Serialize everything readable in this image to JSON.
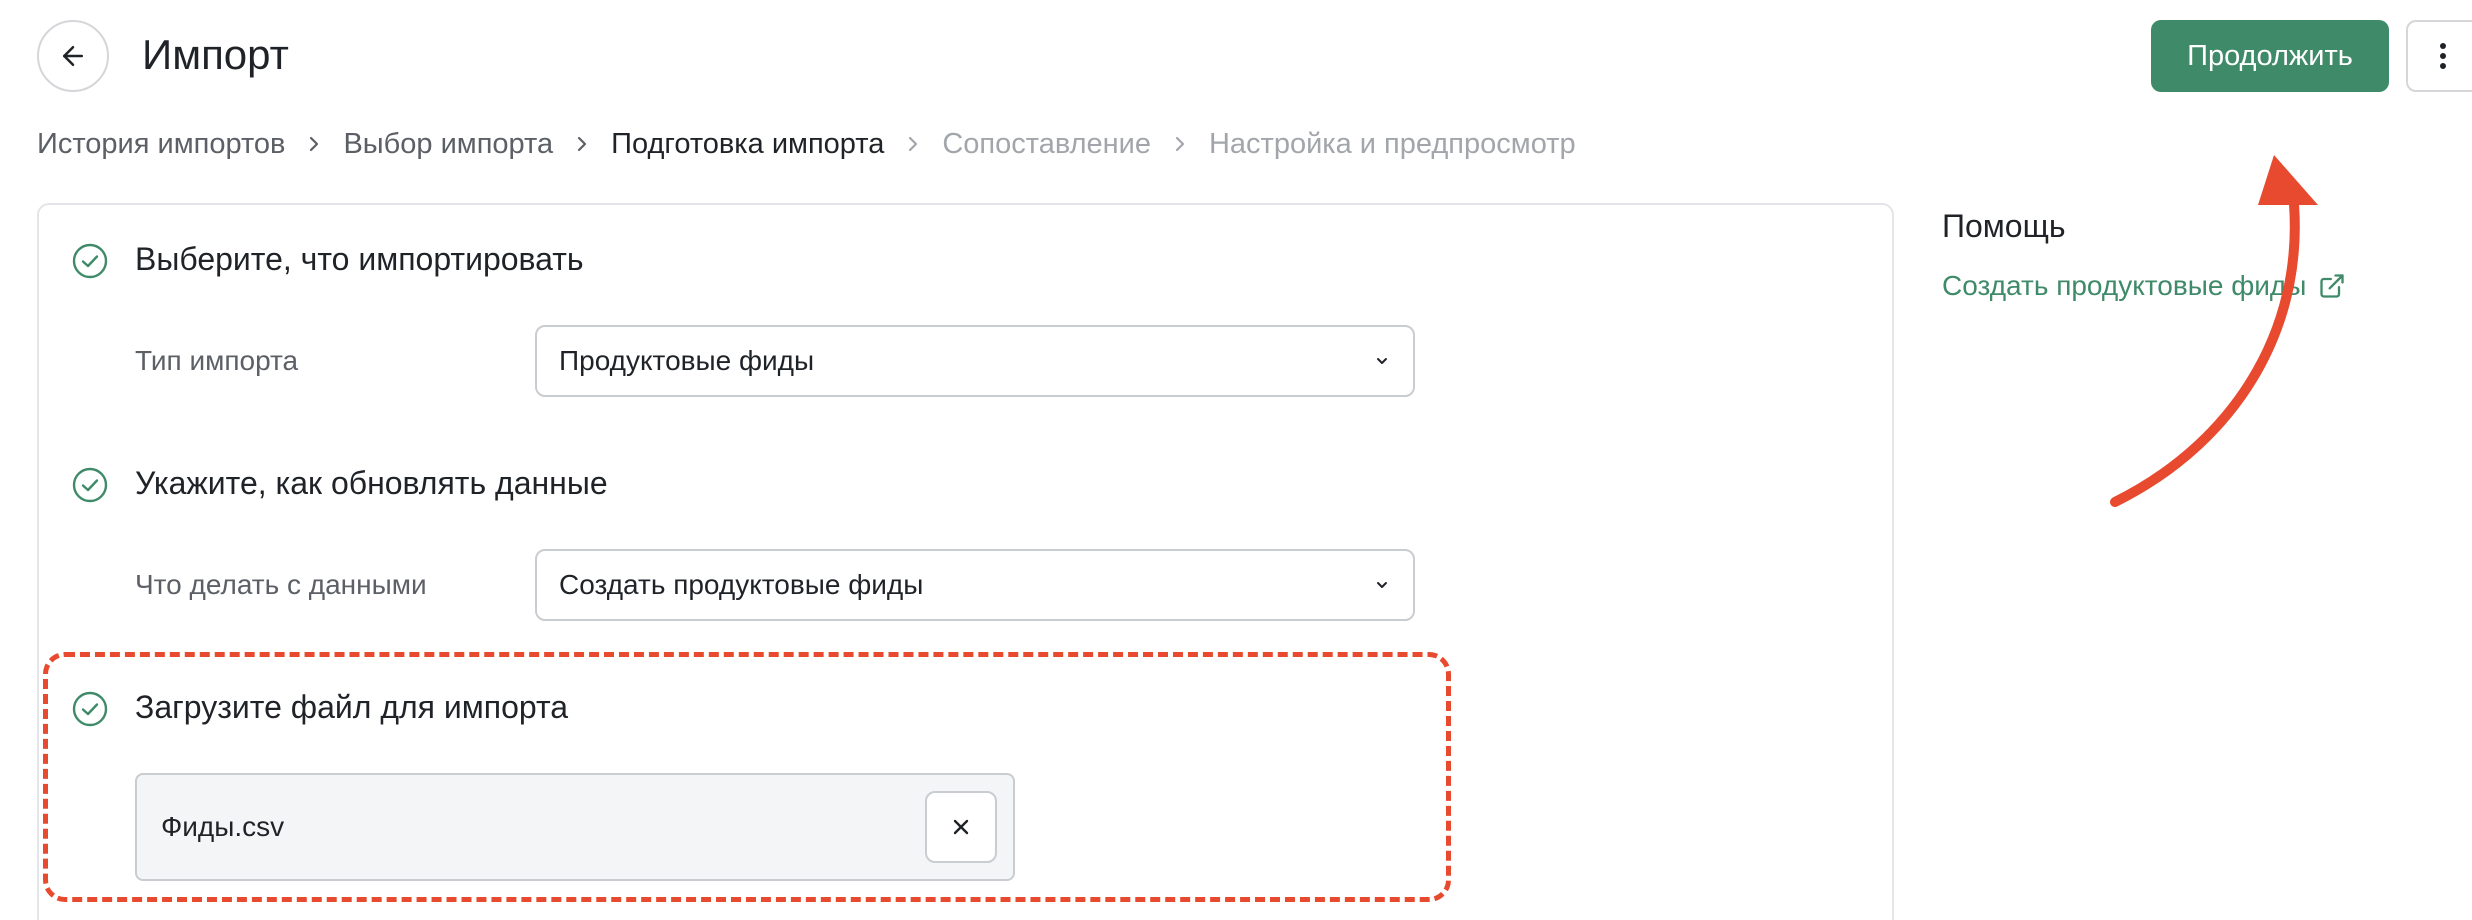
{
  "header": {
    "title": "Импорт",
    "continue_label": "Продолжить"
  },
  "breadcrumb": [
    {
      "label": "История импортов",
      "state": "done"
    },
    {
      "label": "Выбор импорта",
      "state": "done"
    },
    {
      "label": "Подготовка импорта",
      "state": "current"
    },
    {
      "label": "Сопоставление",
      "state": "future"
    },
    {
      "label": "Настройка и предпросмотр",
      "state": "future"
    }
  ],
  "sections": {
    "what": {
      "title": "Выберите, что импортировать",
      "field_label": "Тип импорта",
      "select_value": "Продуктовые фиды"
    },
    "how": {
      "title": "Укажите, как обновлять данные",
      "field_label": "Что делать с данными",
      "select_value": "Создать продуктовые фиды"
    },
    "upload": {
      "title": "Загрузите файл для импорта",
      "file_name": "Фиды.csv"
    }
  },
  "help": {
    "title": "Помощь",
    "link_label": "Создать продуктовые фиды"
  },
  "colors": {
    "accent": "#3f8a68",
    "annotation": "#e84a30"
  },
  "icons": [
    "arrow-left-icon",
    "more-vertical-icon",
    "chevron-right-icon",
    "check-circle-icon",
    "chevron-down-icon",
    "close-icon",
    "external-link-icon"
  ]
}
